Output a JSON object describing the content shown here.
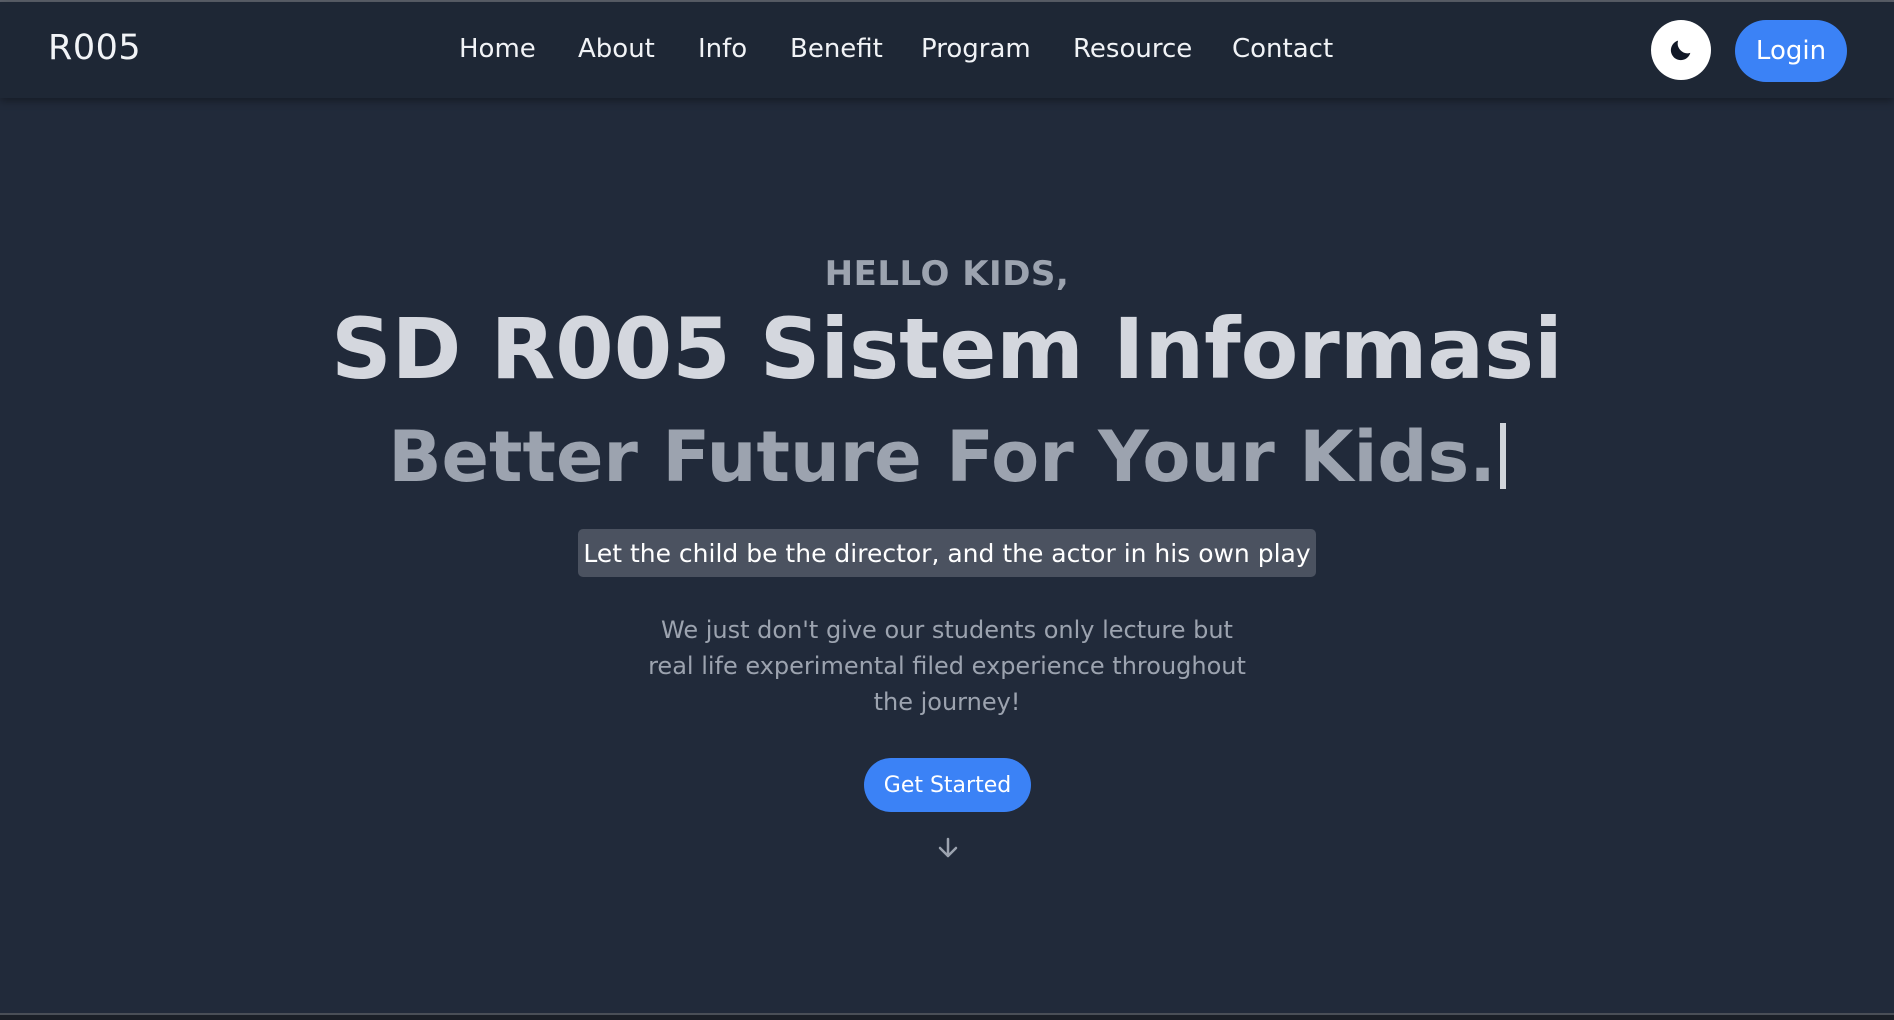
{
  "header": {
    "brand": "R005",
    "nav": [
      {
        "label": "Home"
      },
      {
        "label": "About"
      },
      {
        "label": "Info"
      },
      {
        "label": "Benefit"
      },
      {
        "label": "Program"
      },
      {
        "label": "Resource"
      },
      {
        "label": "Contact"
      }
    ],
    "theme_toggle_icon": "moon-icon",
    "login_label": "Login"
  },
  "hero": {
    "greeting": "HELLO KIDS,",
    "title": "SD R005 Sistem Informasi",
    "subtitle": "Better Future For Your Kids.",
    "quote": "Let the child be the director, and the actor in his own play",
    "description": "We just don't give our students only lecture but real life experimental filed experience throughout the journey!",
    "cta_label": "Get Started",
    "scroll_icon": "arrow-down-icon"
  },
  "colors": {
    "background": "#212a3a",
    "header_bg": "#1e2735",
    "accent": "#3b82f6",
    "muted_text": "#9ca3af",
    "title_text": "#d4d7de"
  }
}
